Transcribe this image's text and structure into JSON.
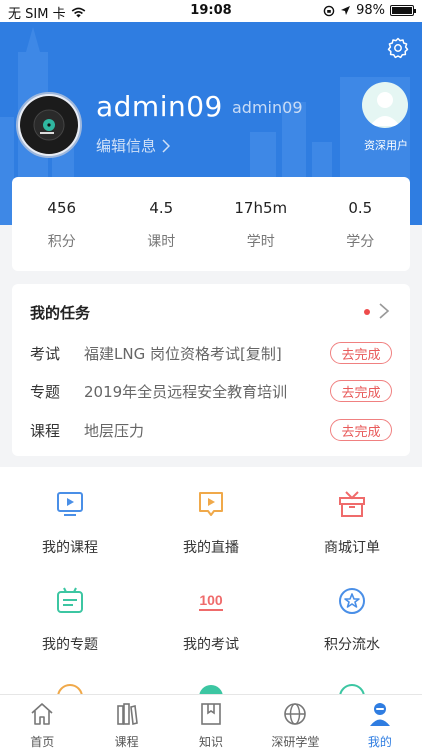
{
  "status_bar": {
    "carrier": "无 SIM 卡",
    "time": "19:08",
    "battery": "98%",
    "battery_level": 0.98
  },
  "profile": {
    "username": "admin09",
    "username_sub": "admin09",
    "edit_label": "编辑信息",
    "role_label": "资深用户"
  },
  "stats": [
    {
      "value": "456",
      "label": "积分"
    },
    {
      "value": "4.5",
      "label": "课时"
    },
    {
      "value": "17h5m",
      "label": "学时"
    },
    {
      "value": "0.5",
      "label": "学分"
    }
  ],
  "tasks": {
    "title": "我的任务",
    "items": [
      {
        "type": "考试",
        "name": "福建LNG 岗位资格考试[复制]",
        "action": "去完成"
      },
      {
        "type": "专题",
        "name": "2019年全员远程安全教育培训",
        "action": "去完成"
      },
      {
        "type": "课程",
        "name": "地层压力",
        "action": "去完成"
      }
    ]
  },
  "grid": [
    {
      "label": "我的课程",
      "icon": "play-icon",
      "color": "#4a8fe7"
    },
    {
      "label": "我的直播",
      "icon": "live-icon",
      "color": "#f0a94a"
    },
    {
      "label": "商城订单",
      "icon": "gift-icon",
      "color": "#ef6b6b"
    },
    {
      "label": "我的专题",
      "icon": "topic-icon",
      "color": "#3cc6a2"
    },
    {
      "label": "我的考试",
      "icon": "exam-100-icon",
      "color": "#ef6b6b"
    },
    {
      "label": "积分流水",
      "icon": "star-badge-icon",
      "color": "#4a8fe7"
    }
  ],
  "tabs": [
    {
      "label": "首页",
      "icon": "home-icon"
    },
    {
      "label": "课程",
      "icon": "books-icon"
    },
    {
      "label": "知识",
      "icon": "book-icon"
    },
    {
      "label": "深研学堂",
      "icon": "globe-icon"
    },
    {
      "label": "我的",
      "icon": "person-icon",
      "active": true
    }
  ],
  "colors": {
    "primary": "#2f7de1",
    "accent_red": "#e85a5a"
  }
}
